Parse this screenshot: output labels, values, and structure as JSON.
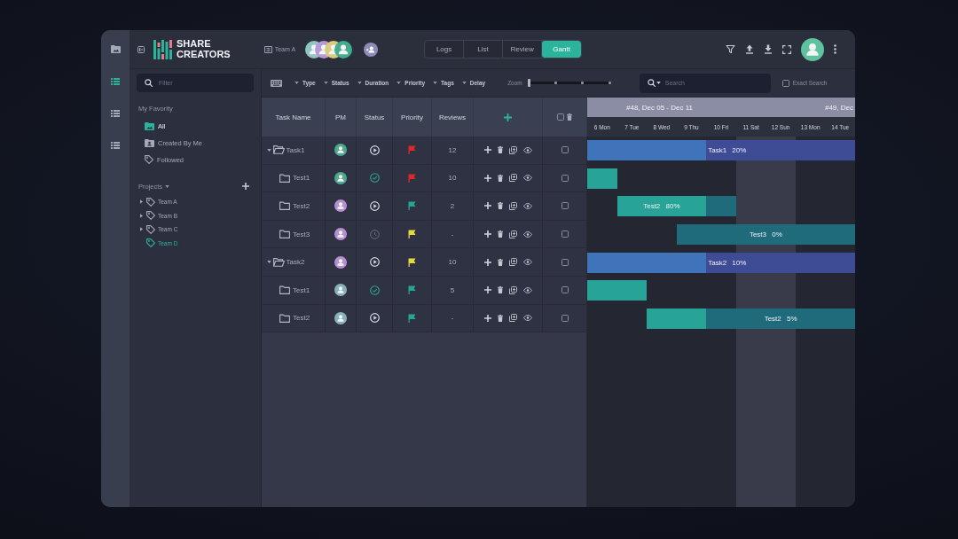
{
  "rail": {
    "items": [
      {
        "kind": "folder",
        "selected": false
      },
      {
        "kind": "list",
        "selected": true
      },
      {
        "kind": "list",
        "selected": false
      },
      {
        "kind": "list",
        "selected": false
      }
    ]
  },
  "header": {
    "logo": {
      "line_1": "SHARE",
      "line_2": "CREATORS"
    },
    "team": "Team A",
    "members": [
      {
        "color": "#8ec6c1"
      },
      {
        "color": "#b79bd8"
      },
      {
        "color": "#dccb79"
      },
      {
        "color": "#43ad8b"
      }
    ],
    "views": [
      {
        "label": "Logs",
        "selected": false
      },
      {
        "label": "List",
        "selected": false
      },
      {
        "label": "Review",
        "selected": false
      },
      {
        "label": "Gantt",
        "selected": true
      }
    ]
  },
  "sidebar": {
    "filter": {
      "placeholder": "Filter"
    },
    "favorites": {
      "title": "My Favority",
      "items": [
        {
          "kind": "all",
          "label": "All",
          "selected": true
        },
        {
          "kind": "mine",
          "label": "Created By Me",
          "selected": false
        },
        {
          "kind": "followed",
          "label": "Followed",
          "selected": false
        }
      ]
    },
    "projects": {
      "title": "Projects",
      "items": [
        {
          "kind": "branch",
          "label": "Team A",
          "expanded": false,
          "selected": false
        },
        {
          "kind": "branch",
          "label": "Team B",
          "expanded": false,
          "selected": false
        },
        {
          "kind": "branch",
          "label": "Team C",
          "expanded": false,
          "selected": false
        },
        {
          "kind": "leaf",
          "label": "Team D",
          "selected": true
        }
      ]
    }
  },
  "toolbar": {
    "filters": [
      "Type",
      "Status",
      "Duration",
      "Priority",
      "Tags",
      "Delay"
    ],
    "zoom": {
      "label": "Zoom",
      "level": 0
    },
    "search": {
      "placeholder": "Search"
    },
    "exact_search": {
      "label": "Exact Search",
      "checked": false
    }
  },
  "table": {
    "columns": [
      "Task Name",
      "PM",
      "Status",
      "Priority",
      "Reviews"
    ],
    "select_all": {
      "checked": false
    },
    "rows": [
      {
        "kind": "group",
        "name": "Task1",
        "expanded": true,
        "color": "#4dab8c",
        "status": {
          "kind": "running"
        },
        "priority": {
          "color": "#e3262b"
        },
        "reviews": "12",
        "checked": false
      },
      {
        "kind": "task",
        "name": "Test1",
        "color": "#4dab8c",
        "status": {
          "kind": "done"
        },
        "priority": {
          "color": "#e3262b"
        },
        "reviews": "10",
        "checked": false
      },
      {
        "kind": "task",
        "name": "Test2",
        "color": "#b58fcf",
        "status": {
          "kind": "running"
        },
        "priority": {
          "color": "#25a596"
        },
        "reviews": "2",
        "checked": false
      },
      {
        "kind": "task",
        "name": "Test3",
        "color": "#b58fcf",
        "status": {
          "kind": "waiting"
        },
        "priority": {
          "color": "#e6d83a"
        },
        "reviews": "-",
        "checked": false
      },
      {
        "kind": "group",
        "name": "Task2",
        "expanded": true,
        "color": "#b58fcf",
        "status": {
          "kind": "running"
        },
        "priority": {
          "color": "#e6d83a"
        },
        "reviews": "10",
        "checked": false
      },
      {
        "kind": "task",
        "name": "Test1",
        "color": "#86afb7",
        "status": {
          "kind": "done"
        },
        "priority": {
          "color": "#25a596"
        },
        "reviews": "5",
        "checked": false
      },
      {
        "kind": "task",
        "name": "Test2",
        "color": "#86afb7",
        "status": {
          "kind": "running"
        },
        "priority": {
          "color": "#25a596"
        },
        "reviews": "-",
        "checked": false
      }
    ]
  },
  "gantt": {
    "weeks": [
      "#48, Dec 05 - Dec 11",
      "#49, Dec"
    ],
    "days": [
      {
        "label": "6 Mon",
        "weekend": false
      },
      {
        "label": "7 Tue",
        "weekend": false
      },
      {
        "label": "8 Wed",
        "weekend": false
      },
      {
        "label": "9 Thu",
        "weekend": false
      },
      {
        "label": "10 Fri",
        "weekend": false
      },
      {
        "label": "11 Sat",
        "weekend": true
      },
      {
        "label": "12 Sun",
        "weekend": true
      },
      {
        "label": "13 Mon",
        "weekend": false
      },
      {
        "label": "14 Tue",
        "weekend": false
      }
    ],
    "bars": [
      {
        "kind": "summary",
        "label": "Task1 20%",
        "days": [
          {
            "kind": "done"
          },
          {
            "kind": "done"
          },
          {
            "kind": "done"
          },
          {
            "kind": "done"
          },
          {
            "kind": "open"
          },
          {
            "kind": "open"
          },
          {
            "kind": "open"
          },
          {
            "kind": "open"
          },
          {
            "kind": "open"
          }
        ]
      },
      {
        "kind": "task",
        "days": [
          {
            "kind": "done"
          },
          {
            "kind": "none"
          },
          {
            "kind": "none"
          },
          {
            "kind": "none"
          },
          {
            "kind": "none"
          },
          {
            "kind": "none"
          },
          {
            "kind": "none"
          },
          {
            "kind": "none"
          },
          {
            "kind": "none"
          }
        ]
      },
      {
        "kind": "task",
        "label": "Test2 80%",
        "days": [
          {
            "kind": "none"
          },
          {
            "kind": "done"
          },
          {
            "kind": "done"
          },
          {
            "kind": "done"
          },
          {
            "kind": "open"
          },
          {
            "kind": "none"
          },
          {
            "kind": "none"
          },
          {
            "kind": "none"
          },
          {
            "kind": "none"
          }
        ]
      },
      {
        "kind": "task",
        "label": "Test3 0%",
        "days": [
          {
            "kind": "none"
          },
          {
            "kind": "none"
          },
          {
            "kind": "none"
          },
          {
            "kind": "open"
          },
          {
            "kind": "open"
          },
          {
            "kind": "open"
          },
          {
            "kind": "open"
          },
          {
            "kind": "open"
          },
          {
            "kind": "open"
          }
        ]
      },
      {
        "kind": "summary",
        "label": "Task2 10%",
        "days": [
          {
            "kind": "done"
          },
          {
            "kind": "done"
          },
          {
            "kind": "done"
          },
          {
            "kind": "done"
          },
          {
            "kind": "open"
          },
          {
            "kind": "open"
          },
          {
            "kind": "open"
          },
          {
            "kind": "open"
          },
          {
            "kind": "open"
          }
        ]
      },
      {
        "kind": "task",
        "days": [
          {
            "kind": "done"
          },
          {
            "kind": "done"
          },
          {
            "kind": "none"
          },
          {
            "kind": "none"
          },
          {
            "kind": "none"
          },
          {
            "kind": "none"
          },
          {
            "kind": "none"
          },
          {
            "kind": "none"
          },
          {
            "kind": "none"
          }
        ]
      },
      {
        "kind": "task",
        "label": "Test2 5%",
        "days": [
          {
            "kind": "none"
          },
          {
            "kind": "none"
          },
          {
            "kind": "done"
          },
          {
            "kind": "done"
          },
          {
            "kind": "open"
          },
          {
            "kind": "open"
          },
          {
            "kind": "open"
          },
          {
            "kind": "open"
          },
          {
            "kind": "open"
          }
        ]
      }
    ]
  }
}
